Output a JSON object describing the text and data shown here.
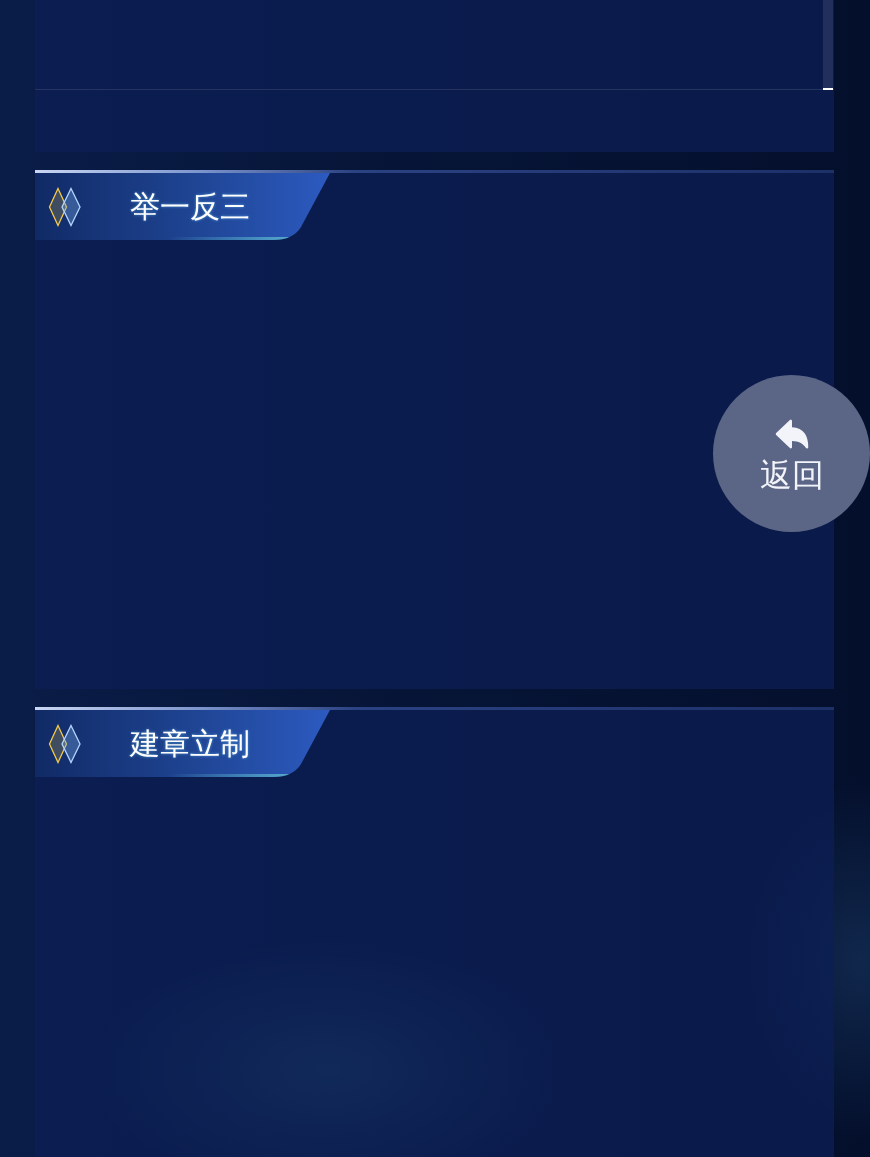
{
  "sections": [
    {
      "title": "举一反三"
    },
    {
      "title": "建章立制"
    }
  ],
  "back_button": {
    "label": "返回"
  }
}
